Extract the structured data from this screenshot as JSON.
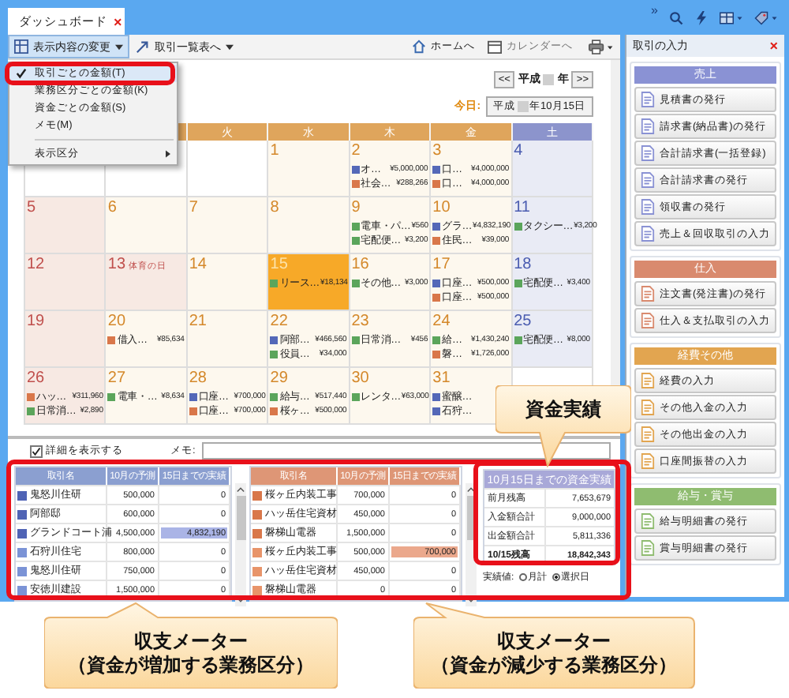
{
  "tab": {
    "title": "ダッシュボード",
    "close": "×"
  },
  "top_icons": {
    "more": "»"
  },
  "toolbar": {
    "display_menu": {
      "label": "表示内容の変更",
      "expanded": true
    },
    "list_button": {
      "label": "取引一覧表へ"
    },
    "home_button": {
      "label": "ホームへ"
    },
    "calendar_button": {
      "label": "カレンダーへ",
      "disabled": true
    }
  },
  "menu": [
    {
      "label": "取引ごとの金額(T)",
      "checked": true,
      "selected": true,
      "kind": "item"
    },
    {
      "label": "業務区分ごとの金額(K)",
      "checked": false,
      "selected": false,
      "kind": "item"
    },
    {
      "label": "資金ごとの金額(S)",
      "checked": false,
      "selected": false,
      "kind": "item"
    },
    {
      "label": "メモ(M)",
      "checked": false,
      "selected": false,
      "kind": "item"
    },
    {
      "label": "表示区分",
      "checked": false,
      "selected": false,
      "kind": "submenu"
    }
  ],
  "calendar": {
    "prev": "<<",
    "next": ">>",
    "year_prefix": "平成",
    "year_suffix": "年",
    "today_label": "今日:",
    "today_prefix": "平成",
    "today_suffix": "年10月15日",
    "weekdays": [
      {
        "kind": "weekday"
      },
      {
        "kind": "weekday",
        "label": "火"
      },
      {
        "kind": "weekday",
        "label": "水"
      },
      {
        "kind": "weekday",
        "label": "木"
      },
      {
        "kind": "weekday",
        "label": "金"
      },
      {
        "kind": "sat",
        "label": "土"
      }
    ],
    "weeks": [
      [
        {
          "kind": "blank"
        },
        {
          "kind": "blank"
        },
        {
          "kind": "blank"
        },
        {
          "day": "1",
          "kind": "weekday",
          "selected": false
        },
        {
          "day": "2",
          "kind": "weekday",
          "selected": false,
          "entries": [
            {
              "label": "オ…",
              "amount": "¥5,000,000",
              "color": "#5468b8"
            },
            {
              "label": "社会…",
              "amount": "¥288,266",
              "color": "#d9774a"
            }
          ]
        },
        {
          "day": "3",
          "kind": "weekday",
          "selected": false,
          "entries": [
            {
              "label": "口…",
              "amount": "¥4,000,000",
              "color": "#5468b8"
            },
            {
              "label": "口…",
              "amount": "¥4,000,000",
              "color": "#d9774a"
            }
          ]
        },
        {
          "day": "4",
          "kind": "sat",
          "selected": false
        }
      ],
      [
        {
          "day": "5",
          "kind": "sun",
          "selected": false
        },
        {
          "day": "6",
          "kind": "weekday",
          "selected": false
        },
        {
          "day": "7",
          "kind": "weekday",
          "selected": false
        },
        {
          "day": "8",
          "kind": "weekday",
          "selected": false
        },
        {
          "day": "9",
          "kind": "weekday",
          "selected": false,
          "entries": [
            {
              "label": "電車・パ…",
              "amount": "¥560",
              "color": "#5ba55b"
            },
            {
              "label": "宅配便…",
              "amount": "¥3,200",
              "color": "#5ba55b"
            }
          ]
        },
        {
          "day": "10",
          "kind": "weekday",
          "selected": false,
          "entries": [
            {
              "label": "グラ…",
              "amount": "¥4,832,190",
              "color": "#5468b8"
            },
            {
              "label": "住民…",
              "amount": "¥39,000",
              "color": "#d9774a"
            }
          ]
        },
        {
          "day": "11",
          "kind": "sat",
          "selected": false,
          "entries": [
            {
              "label": "タクシー…",
              "amount": "¥3,200",
              "color": "#5ba55b"
            }
          ]
        }
      ],
      [
        {
          "day": "12",
          "kind": "sun",
          "selected": false
        },
        {
          "day": "13",
          "kind": "holiday",
          "holiday": "体育の日",
          "selected": false
        },
        {
          "day": "14",
          "kind": "weekday",
          "selected": false
        },
        {
          "day": "15",
          "kind": "weekday",
          "selected": true,
          "entries": [
            {
              "label": "リース…",
              "amount": "¥18,134",
              "color": "#5ba55b"
            }
          ]
        },
        {
          "day": "16",
          "kind": "weekday",
          "selected": false,
          "entries": [
            {
              "label": "その他…",
              "amount": "¥3,000",
              "color": "#5ba55b"
            }
          ]
        },
        {
          "day": "17",
          "kind": "weekday",
          "selected": false,
          "entries": [
            {
              "label": "口座…",
              "amount": "¥500,000",
              "color": "#5468b8"
            },
            {
              "label": "口座…",
              "amount": "¥500,000",
              "color": "#d9774a"
            }
          ]
        },
        {
          "day": "18",
          "kind": "sat",
          "selected": false,
          "entries": [
            {
              "label": "宅配便…",
              "amount": "¥3,400",
              "color": "#5ba55b"
            }
          ]
        }
      ],
      [
        {
          "day": "19",
          "kind": "sun",
          "selected": false
        },
        {
          "day": "20",
          "kind": "weekday",
          "selected": false,
          "entries": [
            {
              "label": "借入…",
              "amount": "¥85,634",
              "color": "#d9774a"
            }
          ]
        },
        {
          "day": "21",
          "kind": "weekday",
          "selected": false
        },
        {
          "day": "22",
          "kind": "weekday",
          "selected": false,
          "entries": [
            {
              "label": "阿部…",
              "amount": "¥466,560",
              "color": "#5468b8"
            },
            {
              "label": "役員…",
              "amount": "¥34,000",
              "color": "#5ba55b"
            }
          ]
        },
        {
          "day": "23",
          "kind": "weekday",
          "selected": false,
          "entries": [
            {
              "label": "日常消…",
              "amount": "¥456",
              "color": "#5ba55b"
            }
          ]
        },
        {
          "day": "24",
          "kind": "weekday",
          "selected": false,
          "entries": [
            {
              "label": "給…",
              "amount": "¥1,430,240",
              "color": "#5ba55b"
            },
            {
              "label": "磐…",
              "amount": "¥1,726,000",
              "color": "#d9774a"
            }
          ]
        },
        {
          "day": "25",
          "kind": "sat",
          "selected": false,
          "entries": [
            {
              "label": "宅配便…",
              "amount": "¥8,000",
              "color": "#5ba55b"
            }
          ]
        }
      ],
      [
        {
          "day": "26",
          "kind": "sun",
          "selected": false,
          "entries": [
            {
              "label": "ハッ…",
              "amount": "¥311,960",
              "color": "#d9774a"
            },
            {
              "label": "日常消…",
              "amount": "¥2,890",
              "color": "#5ba55b"
            }
          ]
        },
        {
          "day": "27",
          "kind": "weekday",
          "selected": false,
          "entries": [
            {
              "label": "電車・…",
              "amount": "¥8,634",
              "color": "#5ba55b"
            }
          ]
        },
        {
          "day": "28",
          "kind": "weekday",
          "selected": false,
          "entries": [
            {
              "label": "口座…",
              "amount": "¥700,000",
              "color": "#5468b8"
            },
            {
              "label": "口座…",
              "amount": "¥700,000",
              "color": "#d9774a"
            }
          ]
        },
        {
          "day": "29",
          "kind": "weekday",
          "selected": false,
          "entries": [
            {
              "label": "給与…",
              "amount": "¥517,440",
              "color": "#5ba55b"
            },
            {
              "label": "桜ヶ…",
              "amount": "¥500,000",
              "color": "#d9774a"
            }
          ]
        },
        {
          "day": "30",
          "kind": "weekday",
          "selected": false,
          "entries": [
            {
              "label": "レンタ…",
              "amount": "¥63,000",
              "color": "#5ba55b"
            }
          ]
        },
        {
          "day": "31",
          "kind": "weekday",
          "selected": false,
          "entries": [
            {
              "label": "蜜醸…",
              "color": "#5468b8"
            },
            {
              "label": "石狩…",
              "color": "#5468b8"
            }
          ]
        },
        {
          "kind": "blank"
        }
      ]
    ]
  },
  "details": {
    "show_details": {
      "label": "詳細を表示する",
      "checked": true
    },
    "memo_label": "メモ:"
  },
  "income_meter": {
    "columns": [
      "取引名",
      "10月の予測",
      "15日までの実績"
    ],
    "rows": [
      {
        "name": "鬼怒川住研",
        "forecast": "500,000",
        "actual": "0",
        "color": "#4f63b5"
      },
      {
        "name": "阿部邸",
        "forecast": "600,000",
        "actual": "0",
        "color": "#4f63b5"
      },
      {
        "name": "グランドコート浦",
        "forecast": "4,500,000",
        "actual": "4,832,190",
        "level": 1,
        "color": "#4f63b5"
      },
      {
        "name": "石狩川住宅",
        "forecast": "800,000",
        "actual": "0",
        "color": "#7b93d6"
      },
      {
        "name": "鬼怒川住研",
        "forecast": "750,000",
        "actual": "0",
        "color": "#7b93d6"
      },
      {
        "name": "安徳川建設",
        "forecast": "1,500,000",
        "actual": "0",
        "color": "#7b93d6"
      }
    ]
  },
  "expense_meter": {
    "columns": [
      "取引名",
      "10月の予測",
      "15日までの実績"
    ],
    "rows": [
      {
        "name": "桜ヶ丘内装工事",
        "forecast": "700,000",
        "actual": "0",
        "color": "#d9774a"
      },
      {
        "name": "ハッ岳住宅資材",
        "forecast": "450,000",
        "actual": "0",
        "color": "#d9774a"
      },
      {
        "name": "磐梯山電器",
        "forecast": "1,500,000",
        "actual": "0",
        "color": "#d9774a"
      },
      {
        "name": "桜ヶ丘内装工事",
        "forecast": "500,000",
        "actual": "700,000",
        "level": 1,
        "color": "#e8946a"
      },
      {
        "name": "ハッ岳住宅資材",
        "forecast": "450,000",
        "actual": "0",
        "color": "#e8946a"
      },
      {
        "name": "磐梯山電器",
        "forecast": "0",
        "actual": "0",
        "color": "#e8946a"
      }
    ]
  },
  "cash_summary": {
    "title": "10月15日までの資金実績",
    "rows": [
      {
        "label": "前月残高",
        "value": "7,653,679",
        "kind": "normal"
      },
      {
        "label": "入金額合計",
        "value": "9,000,000",
        "kind": "normal"
      },
      {
        "label": "出金額合計",
        "value": "5,811,336",
        "kind": "normal"
      },
      {
        "label": "10/15残高",
        "value": "18,842,343",
        "kind": "total"
      }
    ],
    "basis_label": "実績値:",
    "options": [
      {
        "label": "月計",
        "selected": false
      },
      {
        "label": "選択日",
        "selected": true
      }
    ]
  },
  "side_panel": {
    "title": "取引の入力",
    "close": "×",
    "groups": [
      {
        "title": "売上",
        "color": "#8a92d4",
        "buttons": [
          "見積書の発行",
          "請求書(納品書)の発行",
          "合計請求書(一括登録)",
          "合計請求書の発行",
          "領収書の発行",
          "売上＆回収取引の入力"
        ]
      },
      {
        "title": "仕入",
        "color": "#d98a6e",
        "buttons": [
          "注文書(発注書)の発行",
          "仕入＆支払取引の入力"
        ]
      },
      {
        "title": "経費その他",
        "color": "#e2a550",
        "buttons": [
          "経費の入力",
          "その他入金の入力",
          "その他出金の入力",
          "口座間振替の入力"
        ]
      },
      {
        "title": "給与・賞与",
        "color": "#8fbc70",
        "buttons": [
          "給与明細書の発行",
          "賞与明細書の発行"
        ]
      }
    ]
  },
  "callouts": [
    {
      "kind": "top",
      "title": "資金実績"
    },
    {
      "kind": "left",
      "title": "収支メーター",
      "subtitle": "（資金が増加する業務区分）"
    },
    {
      "kind": "right",
      "title": "収支メーター",
      "subtitle": "（資金が減少する業務区分）"
    }
  ]
}
